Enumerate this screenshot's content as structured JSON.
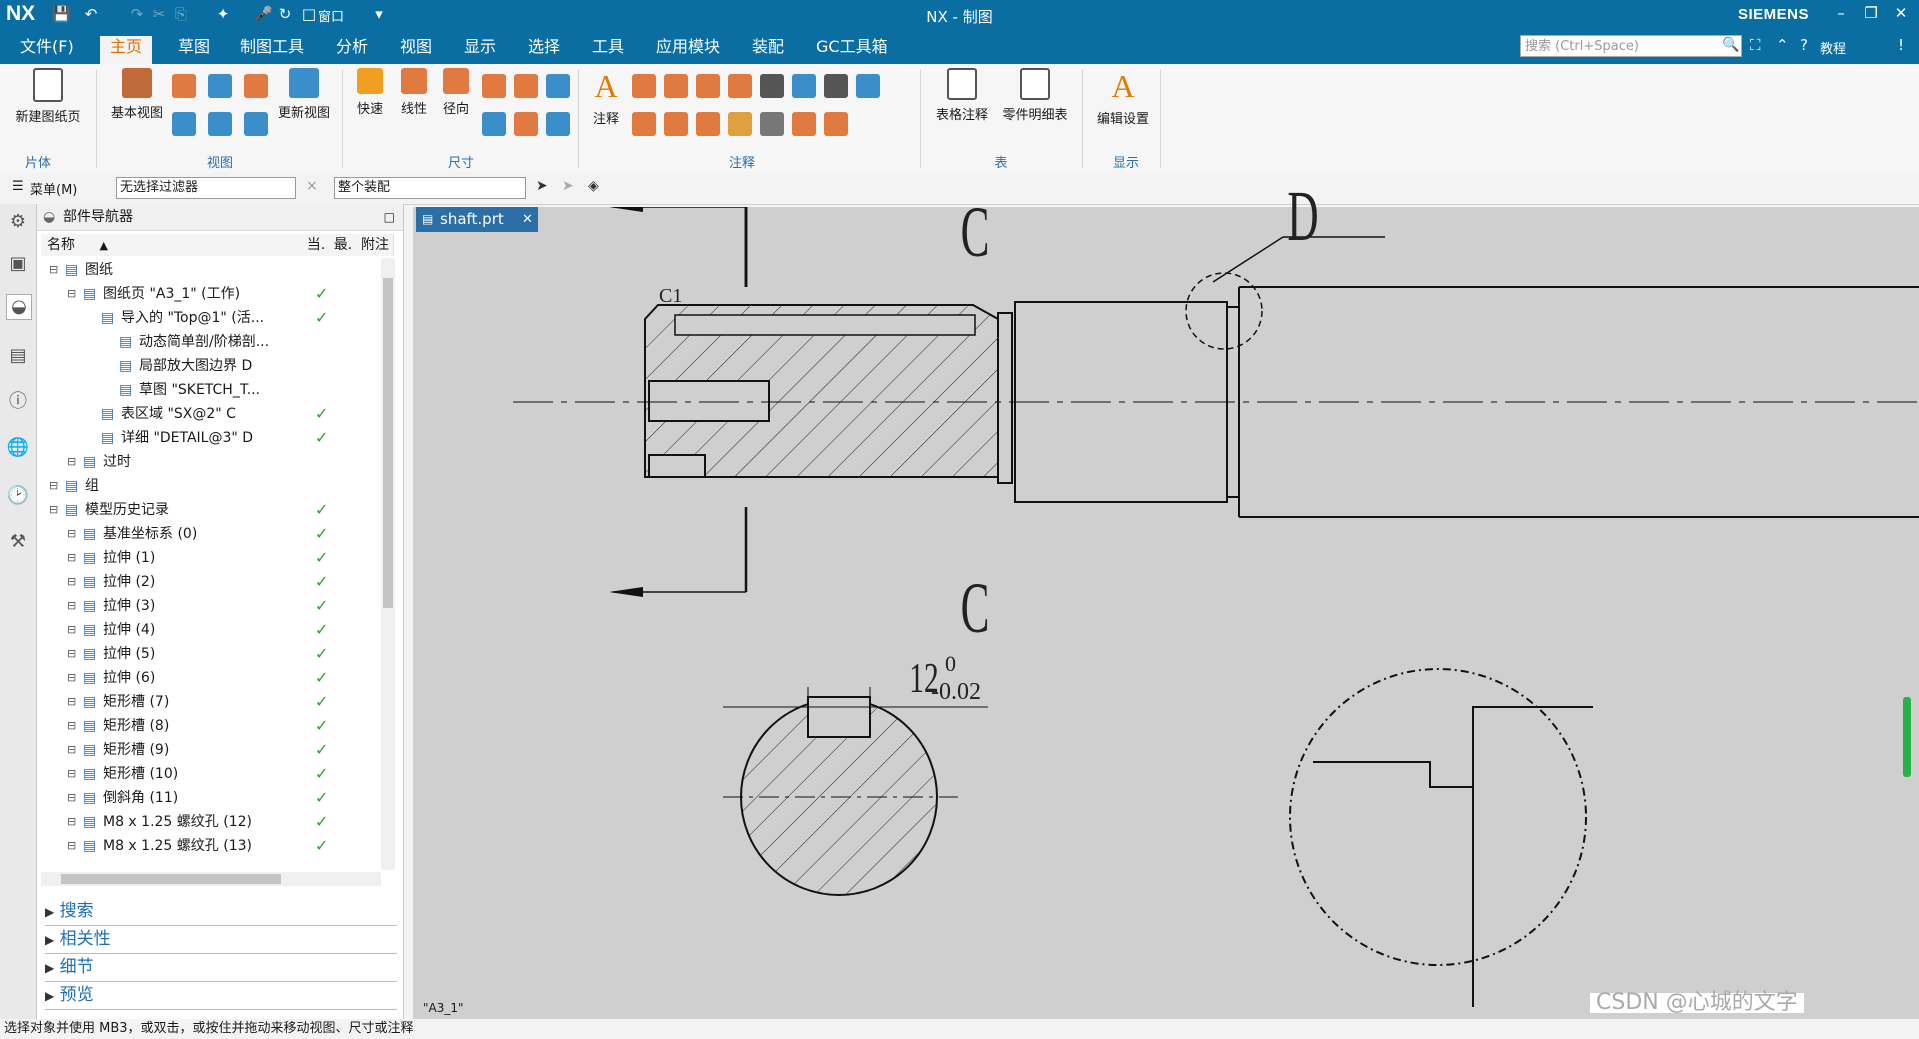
{
  "app": {
    "logo": "NX",
    "title": "NX - 制图",
    "brand": "SIEMENS",
    "window_menu": "窗口",
    "search_placeholder": "搜索 (Ctrl+Space)",
    "tutorial": "教程"
  },
  "menus": [
    "文件(F)",
    "主页",
    "草图",
    "制图工具",
    "分析",
    "视图",
    "显示",
    "选择",
    "工具",
    "应用模块",
    "装配",
    "GC工具箱"
  ],
  "active_menu": "主页",
  "ribbon": {
    "new_sheet": "新建图纸页",
    "base_view": "基本视图",
    "update_views": "更新视图",
    "quick": "快速",
    "linear": "线性",
    "radial": "径向",
    "note": "注释",
    "table_note": "表格注释",
    "parts_list": "零件明细表",
    "edit_settings": "编辑设置",
    "groups": [
      "片体",
      "视图",
      "尺寸",
      "注释",
      "表",
      "显示"
    ]
  },
  "filterbar": {
    "menu": "菜单(M)",
    "selection_filter": "无选择过滤器",
    "scope": "整个装配"
  },
  "navigator": {
    "title": "部件导航器",
    "columns": [
      "名称",
      "当.",
      "最.",
      "附注"
    ],
    "rows": [
      {
        "label": "图纸",
        "indent": 0,
        "check": false
      },
      {
        "label": "图纸页 \"A3_1\" (工作)",
        "indent": 1,
        "check": true
      },
      {
        "label": "导入的 \"Top@1\" (活...",
        "indent": 2,
        "check": true
      },
      {
        "label": "动态简单剖/阶梯剖...",
        "indent": 3,
        "check": false
      },
      {
        "label": "局部放大图边界 D",
        "indent": 3,
        "check": false
      },
      {
        "label": "草图 \"SKETCH_T...",
        "indent": 3,
        "check": false
      },
      {
        "label": "表区域 \"SX@2\" C",
        "indent": 2,
        "check": true
      },
      {
        "label": "详细 \"DETAIL@3\" D",
        "indent": 2,
        "check": true
      },
      {
        "label": "过时",
        "indent": 1,
        "check": false
      },
      {
        "label": "组",
        "indent": 0,
        "check": false
      },
      {
        "label": "模型历史记录",
        "indent": 0,
        "check": true
      },
      {
        "label": "基准坐标系 (0)",
        "indent": 1,
        "check": true
      },
      {
        "label": "拉伸 (1)",
        "indent": 1,
        "check": true
      },
      {
        "label": "拉伸 (2)",
        "indent": 1,
        "check": true
      },
      {
        "label": "拉伸 (3)",
        "indent": 1,
        "check": true
      },
      {
        "label": "拉伸 (4)",
        "indent": 1,
        "check": true
      },
      {
        "label": "拉伸 (5)",
        "indent": 1,
        "check": true
      },
      {
        "label": "拉伸 (6)",
        "indent": 1,
        "check": true
      },
      {
        "label": "矩形槽 (7)",
        "indent": 1,
        "check": true
      },
      {
        "label": "矩形槽 (8)",
        "indent": 1,
        "check": true
      },
      {
        "label": "矩形槽 (9)",
        "indent": 1,
        "check": true
      },
      {
        "label": "矩形槽 (10)",
        "indent": 1,
        "check": true
      },
      {
        "label": "倒斜角 (11)",
        "indent": 1,
        "check": true
      },
      {
        "label": "M8 x 1.25 螺纹孔 (12)",
        "indent": 1,
        "check": true
      },
      {
        "label": "M8 x 1.25 螺纹孔 (13)",
        "indent": 1,
        "check": true
      }
    ],
    "sections": [
      "搜索",
      "相关性",
      "细节",
      "预览"
    ]
  },
  "drawing": {
    "tab": "shaft.prt",
    "sheet_name": "\"A3_1\"",
    "label_c": "C",
    "label_d": "D",
    "label_c1": "C1",
    "dim_main": "12",
    "dim_upper": "0",
    "dim_lower": "-0.02"
  },
  "status": "选择对象并使用 MB3，或双击，或按住并拖动来移动视图、尺寸或注释",
  "watermark": "CSDN @心城的文字"
}
